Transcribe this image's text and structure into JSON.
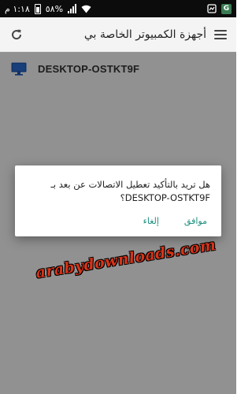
{
  "status_bar": {
    "time": "١:١٨ م",
    "battery_percent": "٥٨%",
    "app_badge": "G"
  },
  "app_bar": {
    "title": "أجهزة الكمبيوتر الخاصة بي",
    "menu_icon": "hamburger-menu-icon",
    "refresh_icon": "refresh-icon"
  },
  "devices": [
    {
      "name": "DESKTOP-OSTKT9F",
      "icon": "monitor-icon"
    }
  ],
  "dialog": {
    "message_line1": "هل تريد بالتأكيد تعطيل الاتصالات عن بعد بـ",
    "message_line2": "DESKTOP-OSTKT9F؟",
    "ok_label": "موافق",
    "cancel_label": "إلغاء",
    "button_color": "#1a8f7d"
  },
  "watermark": {
    "text": "arabydownloads.com",
    "color": "#d93318"
  }
}
